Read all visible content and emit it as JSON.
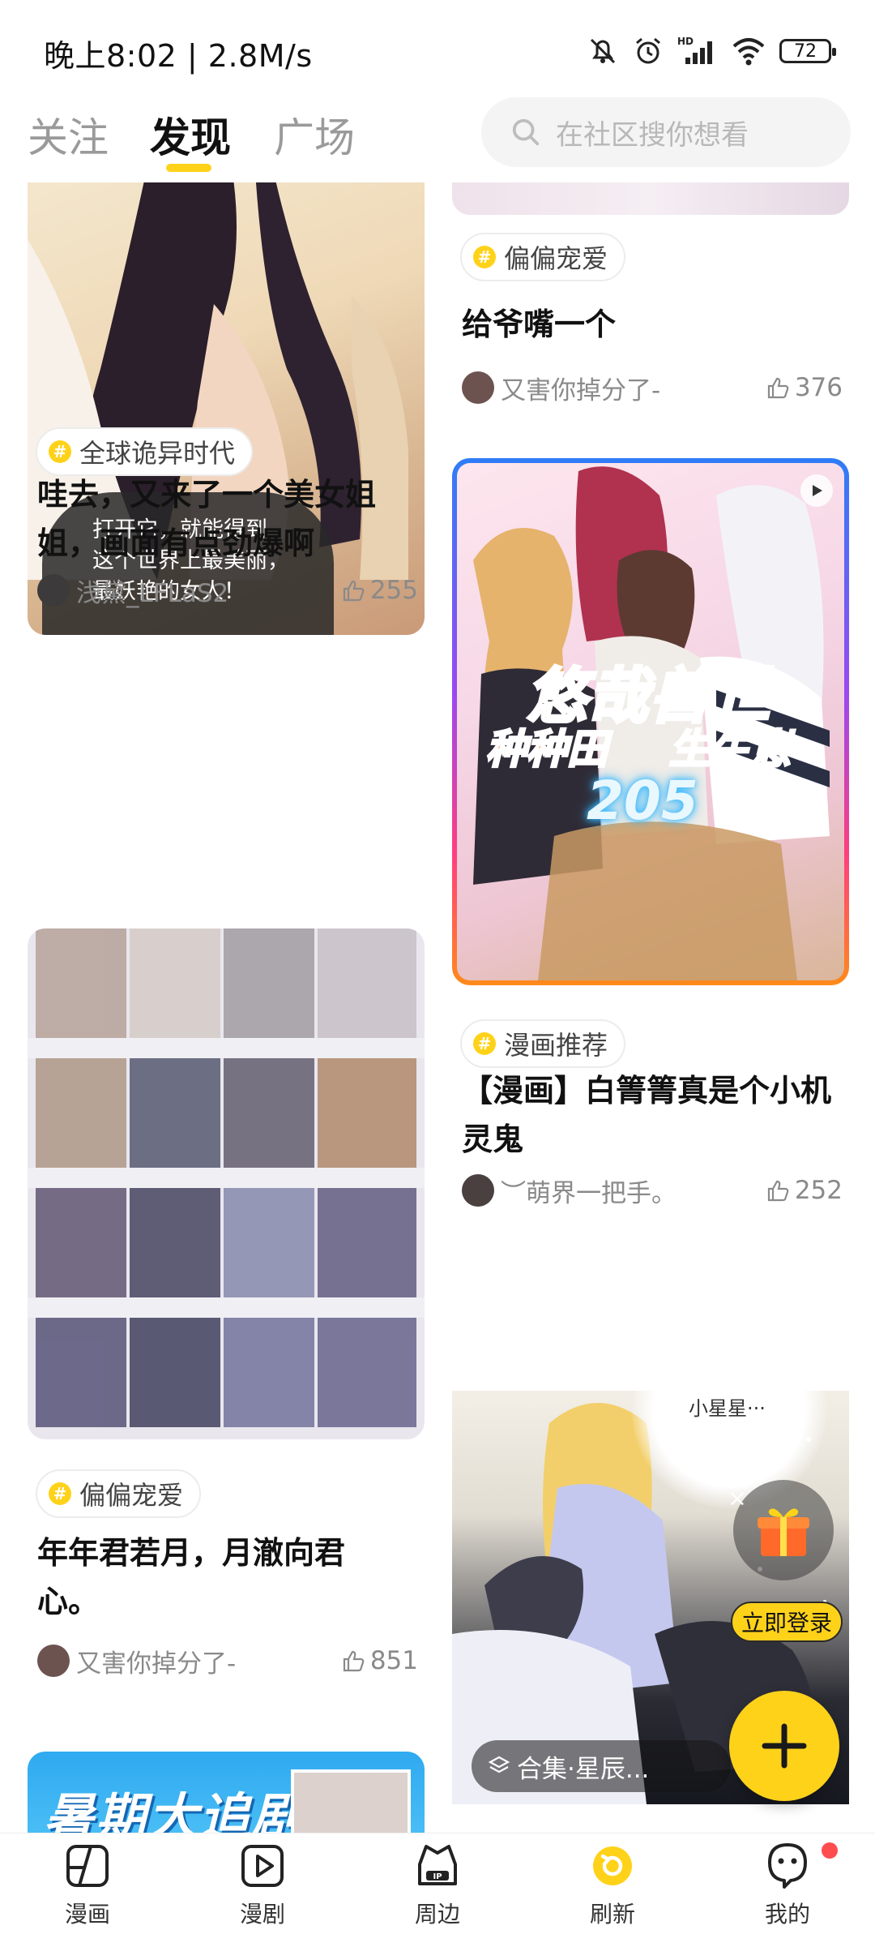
{
  "status_bar": {
    "time_speed": "晚上8:02 | 2.8M/s",
    "network_badge": "HD",
    "battery": "72"
  },
  "header": {
    "tabs": [
      {
        "label": "关注"
      },
      {
        "label": "发现"
      },
      {
        "label": "广场"
      }
    ],
    "search_placeholder": "在社区搜你想看"
  },
  "feed": {
    "left": [
      {
        "cover_caption": "打开它，就能得到\n这个世界上最美丽，\n最妖艳的女人！",
        "topic": "全球诡异时代",
        "title": "哇去，又来了一个美女姐姐，画面有点劲爆啊",
        "author": "浅黛_LFLaS2",
        "likes": "255"
      },
      {
        "topic": "偏偏宠爱",
        "title": "年年君若月，月澈向君心。",
        "author": "又害你掉分了-",
        "likes": "851"
      },
      {
        "cover_title": "暑期大追剧"
      }
    ],
    "right": [
      {
        "topic": "偏偏宠爱",
        "title": "给爷嘴一个",
        "author": "又害你掉分了-",
        "likes": "376"
      },
      {
        "cover_title": "悠哉兽世",
        "cover_subtitle_a": "种种田",
        "cover_subtitle_b": "生生崽",
        "cover_episode": "205",
        "topic": "漫画推荐",
        "title": "【漫画】白箐箐真是个小机灵鬼",
        "author": "︶萌界一把手。",
        "likes": "252"
      },
      {
        "bubble_text": "小星星···",
        "collection_label": "合集·星辰..."
      }
    ]
  },
  "floating": {
    "login_label": "立即登录",
    "fab_symbol": "+"
  },
  "bottom_nav": [
    {
      "label": "漫画",
      "icon": "comic-icon"
    },
    {
      "label": "漫剧",
      "icon": "play-icon"
    },
    {
      "label": "周边",
      "icon": "ip-icon"
    },
    {
      "label": "刷新",
      "icon": "refresh-icon"
    },
    {
      "label": "我的",
      "icon": "profile-icon"
    }
  ],
  "colors": {
    "accent": "#ffd21a",
    "muted_text": "#8a8a8a",
    "notification_dot": "#ff4d4f"
  }
}
